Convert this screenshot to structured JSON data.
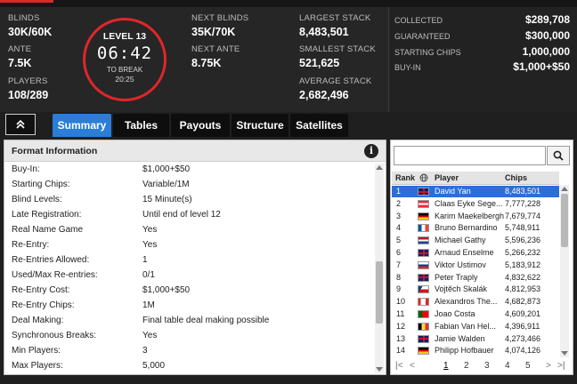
{
  "header": {
    "left_stats": [
      {
        "label": "BLINDS",
        "value": "30K/60K"
      },
      {
        "label": "ANTE",
        "value": "7.5K"
      },
      {
        "label": "PLAYERS",
        "value": "108/289"
      }
    ],
    "clock": {
      "level": "LEVEL 13",
      "time": "06:42",
      "to_break_label": "TO BREAK",
      "to_break_time": "20:25",
      "ring_color": "#e0262a"
    },
    "mid_stats": [
      {
        "label": "NEXT BLINDS",
        "value": "35K/70K"
      },
      {
        "label": "NEXT ANTE",
        "value": "8.75K"
      }
    ],
    "stack_stats": [
      {
        "label": "LARGEST STACK",
        "value": "8,483,501"
      },
      {
        "label": "SMALLEST STACK",
        "value": "521,625"
      },
      {
        "label": "AVERAGE STACK",
        "value": "2,682,496"
      }
    ],
    "right_stats": [
      {
        "label": "COLLECTED",
        "value": "$289,708"
      },
      {
        "label": "GUARANTEED",
        "value": "$300,000"
      },
      {
        "label": "STARTING CHIPS",
        "value": "1,000,000"
      },
      {
        "label": "BUY-IN",
        "value": "$1,000+$50"
      }
    ]
  },
  "tabs": [
    {
      "label": "Summary",
      "active": true
    },
    {
      "label": "Tables",
      "active": false
    },
    {
      "label": "Payouts",
      "active": false
    },
    {
      "label": "Structure",
      "active": false
    },
    {
      "label": "Satellites",
      "active": false
    }
  ],
  "accent_color": "#2a7ed8",
  "format_info": {
    "title": "Format Information",
    "rows": [
      {
        "key": "Buy-In:",
        "value": "$1,000+$50"
      },
      {
        "key": "Starting Chips:",
        "value": "Variable/1M"
      },
      {
        "key": "Blind Levels:",
        "value": "15 Minute(s)"
      },
      {
        "key": "Late Registration:",
        "value": "Until end of level 12"
      },
      {
        "key": "Real Name Game",
        "value": "Yes"
      },
      {
        "key": "Re-Entry:",
        "value": "Yes"
      },
      {
        "key": "Re-Entries Allowed:",
        "value": "1"
      },
      {
        "key": "Used/Max Re-entries:",
        "value": "0/1"
      },
      {
        "key": "Re-Entry Cost:",
        "value": "$1,000+$50"
      },
      {
        "key": "Re-Entry Chips:",
        "value": "1M"
      },
      {
        "key": "Deal Making:",
        "value": "Final table deal making possible"
      },
      {
        "key": "Synchronous Breaks:",
        "value": "Yes"
      },
      {
        "key": "Min Players:",
        "value": "3"
      },
      {
        "key": "Max Players:",
        "value": "5,000"
      }
    ]
  },
  "players": {
    "columns": {
      "rank": "Rank",
      "player": "Player",
      "chips": "Chips"
    },
    "rows": [
      {
        "rank": "1",
        "flag": "gb",
        "name": "David Yan",
        "chips": "8,483,501",
        "selected": true
      },
      {
        "rank": "2",
        "flag": "at",
        "name": "Claas Eyke Sege...",
        "chips": "7,777,228"
      },
      {
        "rank": "3",
        "flag": "de",
        "name": "Karim Maekelbergh",
        "chips": "7,679,774"
      },
      {
        "rank": "4",
        "flag": "fr",
        "name": "Bruno Bernardino",
        "chips": "5,748,911"
      },
      {
        "rank": "5",
        "flag": "nl",
        "name": "Michael Gathy",
        "chips": "5,596,236"
      },
      {
        "rank": "6",
        "flag": "gb",
        "name": "Arnaud Enselme",
        "chips": "5,266,232"
      },
      {
        "rank": "7",
        "flag": "ru",
        "name": "Viktor Ustimov",
        "chips": "5,183,912"
      },
      {
        "rank": "8",
        "flag": "gb",
        "name": "Peter Traply",
        "chips": "4,832,622"
      },
      {
        "rank": "9",
        "flag": "cz",
        "name": "Vojtěch Skalák",
        "chips": "4,812,953"
      },
      {
        "rank": "10",
        "flag": "ca",
        "name": "Alexandros The...",
        "chips": "4,682,873"
      },
      {
        "rank": "11",
        "flag": "pt",
        "name": "Joao Costa",
        "chips": "4,609,201"
      },
      {
        "rank": "12",
        "flag": "be",
        "name": "Fabian Van Hel...",
        "chips": "4,396,911"
      },
      {
        "rank": "13",
        "flag": "gb",
        "name": "Jamie Walden",
        "chips": "4,273,466"
      },
      {
        "rank": "14",
        "flag": "de",
        "name": "Philipp Hofbauer",
        "chips": "4,074,126"
      }
    ],
    "pager": {
      "first": "|<",
      "prev": "<",
      "pages": [
        "1",
        "2",
        "3",
        "4",
        "5"
      ],
      "current": "1",
      "next": ">",
      "last": ">|"
    },
    "selected_color": "#2a6fd8"
  },
  "icons": {
    "collapse": "chevron-up-double-icon",
    "info": "info-icon",
    "search": "search-icon",
    "globe": "globe-icon"
  }
}
